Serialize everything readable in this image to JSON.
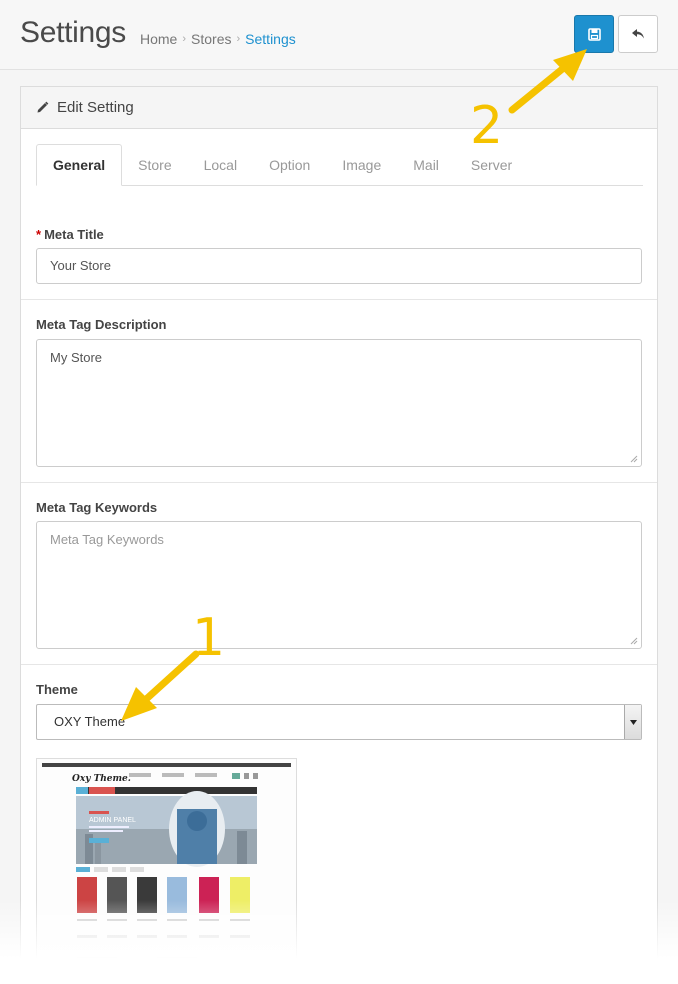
{
  "header": {
    "title": "Settings",
    "breadcrumb": [
      "Home",
      "Stores",
      "Settings"
    ],
    "breadcrumb_separator": "›",
    "save_icon": "floppy-disk-icon",
    "back_icon": "reply-arrow-icon"
  },
  "panel": {
    "heading_icon": "pencil-icon",
    "heading": "Edit Setting"
  },
  "tabs": [
    "General",
    "Store",
    "Local",
    "Option",
    "Image",
    "Mail",
    "Server"
  ],
  "active_tab": "General",
  "form": {
    "meta_title": {
      "label": "Meta Title",
      "required_mark": "*",
      "value": "Your Store"
    },
    "meta_description": {
      "label": "Meta Tag Description",
      "value": "My Store"
    },
    "meta_keywords": {
      "label": "Meta Tag Keywords",
      "placeholder": "Meta Tag Keywords"
    },
    "theme": {
      "label": "Theme",
      "value": "OXY Theme"
    }
  },
  "theme_preview": {
    "logo": "Oxy Theme.",
    "banner": "ADMIN PANEL"
  },
  "annotations": {
    "one": "1",
    "two": "2"
  },
  "colors": {
    "primary": "#1e91cf",
    "annotation": "#f5c200",
    "required": "#cc0000"
  }
}
